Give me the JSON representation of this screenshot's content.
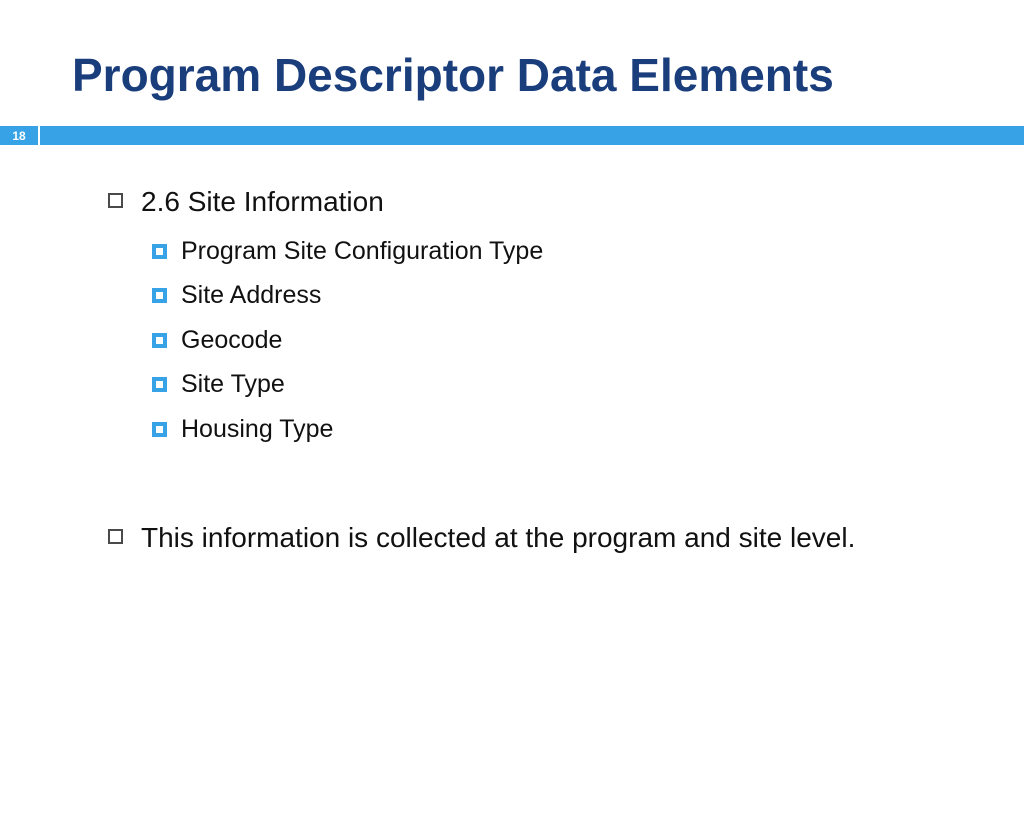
{
  "slide": {
    "title": "Program Descriptor Data Elements",
    "page_number": "18",
    "top_items": [
      "2.6  Site Information",
      "This information is collected at the program and site level."
    ],
    "sub_items": [
      "Program Site Configuration Type",
      "Site Address",
      "Geocode",
      "Site Type",
      "Housing Type"
    ]
  }
}
